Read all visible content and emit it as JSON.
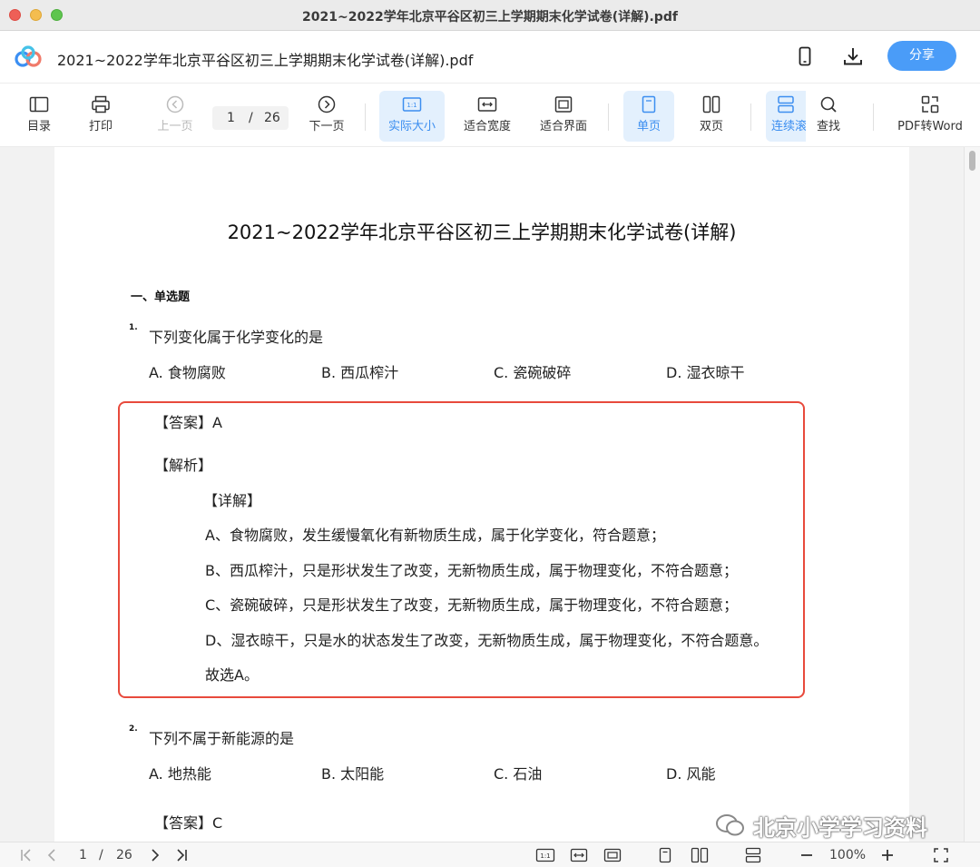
{
  "window": {
    "title": "2021~2022学年北京平谷区初三上学期期末化学试卷(详解).pdf"
  },
  "header": {
    "doc_title": "2021~2022学年北京平谷区初三上学期期末化学试卷(详解).pdf",
    "share_label": "分享",
    "icons": [
      "app-logo-icon",
      "phone-icon",
      "download-icon"
    ]
  },
  "toolbar": {
    "toc": "目录",
    "print": "打印",
    "prev": "上一页",
    "page_current": "1",
    "page_sep": "/",
    "page_total": "26",
    "next": "下一页",
    "actual_size": "实际大小",
    "fit_width": "适合宽度",
    "fit_screen": "适合界面",
    "single": "单页",
    "double": "双页",
    "continuous": "连续滚",
    "find": "查找",
    "pdf_to_word": "PDF转Word",
    "active_color": "#3c8ef0"
  },
  "document": {
    "title": "2021~2022学年北京平谷区初三上学期期末化学试卷(详解)",
    "section": "一、单选题",
    "q1": {
      "num": "1.",
      "text": "下列变化属于化学变化的是",
      "options": [
        "A. 食物腐败",
        "B. 西瓜榨汁",
        "C. 瓷碗破碎",
        "D. 湿衣晾干"
      ],
      "answer": "【答案】A",
      "analysis": "【解析】",
      "detail": "【详解】",
      "lines": [
        "A、食物腐败，发生缓慢氧化有新物质生成，属于化学变化，符合题意；",
        "B、西瓜榨汁，只是形状发生了改变，无新物质生成，属于物理变化，不符合题意；",
        "C、瓷碗破碎，只是形状发生了改变，无新物质生成，属于物理变化，不符合题意；",
        "D、湿衣晾干，只是水的状态发生了改变，无新物质生成，属于物理变化，不符合题意。",
        "故选A。"
      ]
    },
    "q2": {
      "num": "2.",
      "text": "下列不属于新能源的是",
      "options": [
        "A. 地热能",
        "B. 太阳能",
        "C. 石油",
        "D. 风能"
      ],
      "answer": "【答案】C"
    },
    "highlight_color": "#e84a3c"
  },
  "watermark": {
    "text": "北京小学学习资料"
  },
  "statusbar": {
    "page_current": "1",
    "page_sep": "/",
    "page_total": "26",
    "zoom": "100%"
  }
}
